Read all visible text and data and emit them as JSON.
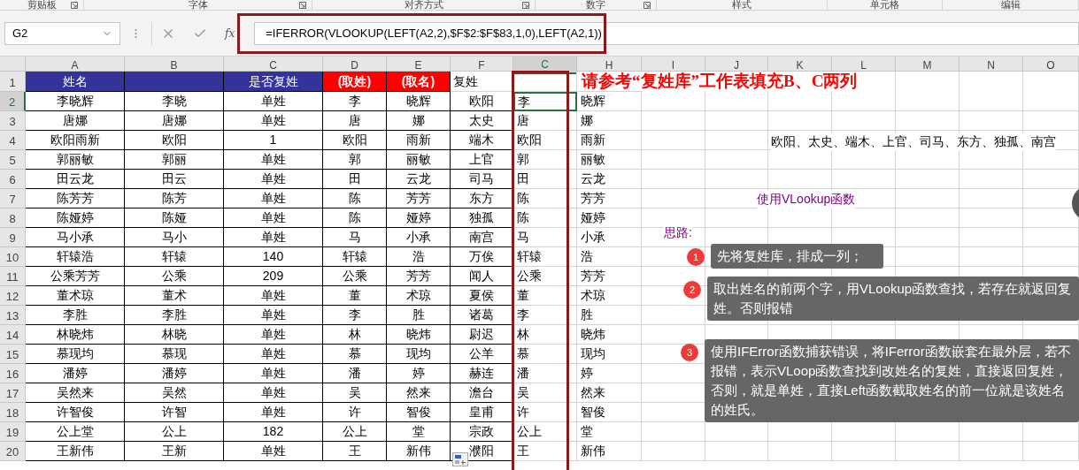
{
  "ribbon_groups": [
    {
      "label": "剪贴板",
      "launcher": true
    },
    {
      "label": "字体",
      "launcher": true
    },
    {
      "label": "对齐方式",
      "launcher": true
    },
    {
      "label": "数字",
      "launcher": true
    },
    {
      "label": "样式"
    },
    {
      "label": "单元格"
    },
    {
      "label": "编辑"
    }
  ],
  "formula_bar": {
    "name_box": "G2",
    "fx_label": "fx",
    "formula": "=IFERROR(VLOOKUP(LEFT(A2,2),$F$2:$F$83,1,0),LEFT(A2,1))"
  },
  "columns": [
    {
      "label": "A",
      "selected": false
    },
    {
      "label": "B",
      "selected": false
    },
    {
      "label": "C",
      "selected": false
    },
    {
      "label": "D",
      "selected": false
    },
    {
      "label": "E",
      "selected": false
    },
    {
      "label": "F",
      "selected": false
    },
    {
      "label": "C",
      "selected": true
    },
    {
      "label": "H",
      "selected": false
    },
    {
      "label": "I",
      "selected": false
    },
    {
      "label": "J",
      "selected": false
    },
    {
      "label": "K",
      "selected": false
    },
    {
      "label": "L",
      "selected": false
    },
    {
      "label": "M",
      "selected": false
    },
    {
      "label": "N",
      "selected": false
    },
    {
      "label": "O",
      "selected": false
    }
  ],
  "header_row": {
    "number": "1",
    "cells": [
      {
        "kind": "blue",
        "text": "姓名"
      },
      {
        "kind": "blue"
      },
      {
        "kind": "blue",
        "text": "是否复姓"
      },
      {
        "kind": "red",
        "text": "(取姓)"
      },
      {
        "kind": "red",
        "text": "(取名)"
      },
      {
        "kind": "plain",
        "text": "复姓"
      }
    ]
  },
  "rows": [
    {
      "number": "2",
      "active": true,
      "cells": [
        "李晓辉",
        "李晓",
        "单姓",
        "李",
        "晓辉",
        "欧阳",
        "李",
        "晓辉"
      ]
    },
    {
      "number": "3",
      "active": false,
      "cells": [
        "唐娜",
        "唐娜",
        "单姓",
        "唐",
        "娜",
        "太史",
        "唐",
        "娜"
      ]
    },
    {
      "number": "4",
      "active": false,
      "cells": [
        "欧阳雨新",
        "欧阳",
        "1",
        "欧阳",
        "雨新",
        "端木",
        "欧阳",
        "雨新"
      ]
    },
    {
      "number": "5",
      "active": false,
      "cells": [
        "郭丽敏",
        "郭丽",
        "单姓",
        "郭",
        "丽敏",
        "上官",
        "郭",
        "丽敏"
      ]
    },
    {
      "number": "6",
      "active": false,
      "cells": [
        "田云龙",
        "田云",
        "单姓",
        "田",
        "云龙",
        "司马",
        "田",
        "云龙"
      ]
    },
    {
      "number": "7",
      "active": false,
      "cells": [
        "陈芳芳",
        "陈芳",
        "单姓",
        "陈",
        "芳芳",
        "东方",
        "陈",
        "芳芳"
      ]
    },
    {
      "number": "8",
      "active": false,
      "cells": [
        "陈娅婷",
        "陈娅",
        "单姓",
        "陈",
        "娅婷",
        "独孤",
        "陈",
        "娅婷"
      ]
    },
    {
      "number": "9",
      "active": false,
      "cells": [
        "马小承",
        "马小",
        "单姓",
        "马",
        "小承",
        "南宫",
        "马",
        "小承"
      ]
    },
    {
      "number": "10",
      "active": false,
      "cells": [
        "轩辕浩",
        "轩辕",
        "140",
        "轩辕",
        "浩",
        "万俟",
        "轩辕",
        "浩"
      ]
    },
    {
      "number": "11",
      "active": false,
      "cells": [
        "公乘芳芳",
        "公乘",
        "209",
        "公乘",
        "芳芳",
        "闻人",
        "公乘",
        "芳芳"
      ]
    },
    {
      "number": "12",
      "active": false,
      "cells": [
        "董术琼",
        "董术",
        "单姓",
        "董",
        "术琼",
        "夏侯",
        "董",
        "术琼"
      ]
    },
    {
      "number": "13",
      "active": false,
      "cells": [
        "李胜",
        "李胜",
        "单姓",
        "李",
        "胜",
        "诸葛",
        "李",
        "胜"
      ]
    },
    {
      "number": "14",
      "active": false,
      "cells": [
        "林晓炜",
        "林晓",
        "单姓",
        "林",
        "晓炜",
        "尉迟",
        "林",
        "晓炜"
      ]
    },
    {
      "number": "15",
      "active": false,
      "cells": [
        "慕现均",
        "慕现",
        "单姓",
        "慕",
        "现均",
        "公羊",
        "慕",
        "现均"
      ]
    },
    {
      "number": "16",
      "active": false,
      "cells": [
        "潘婷",
        "潘婷",
        "单姓",
        "潘",
        "婷",
        "赫连",
        "潘",
        "婷"
      ]
    },
    {
      "number": "17",
      "active": false,
      "cells": [
        "吴然来",
        "吴然",
        "单姓",
        "吴",
        "然来",
        "澹台",
        "吴",
        "然来"
      ]
    },
    {
      "number": "18",
      "active": false,
      "cells": [
        "许智俊",
        "许智",
        "单姓",
        "许",
        "智俊",
        "皇甫",
        "许",
        "智俊"
      ]
    },
    {
      "number": "19",
      "active": false,
      "cells": [
        "公上堂",
        "公上",
        "182",
        "公上",
        "堂",
        "宗政",
        "公上",
        "堂"
      ]
    },
    {
      "number": "20",
      "active": false,
      "cells": [
        "王新伟",
        "王新",
        "单姓",
        "王",
        "新伟",
        "濮阳",
        "王",
        "新伟"
      ]
    }
  ],
  "sheet_notes": {
    "title": "请参考“复姓库”工作表填充B、C两列",
    "surname_list": "欧阳、太史、端木、上官、司马、东方、独孤、南宫",
    "hint": "使用VLookup函数",
    "idea_label": "思路:"
  },
  "callouts": [
    {
      "number": "1",
      "text": "先将复姓库，排成一列；"
    },
    {
      "number": "2",
      "text": "取出姓名的前两个字，用VLookup函数查找，若存在就返回复姓。否则报错"
    },
    {
      "number": "3",
      "text": "使用IFError函数捕获错误，将IFerror函数嵌套在最外层，若不报错，表示VLoop函数查找到改姓名的复姓，直接返回复姓，否则，就是单姓，直接Left函数截取姓名的前一位就是该姓名的姓氏。"
    }
  ]
}
